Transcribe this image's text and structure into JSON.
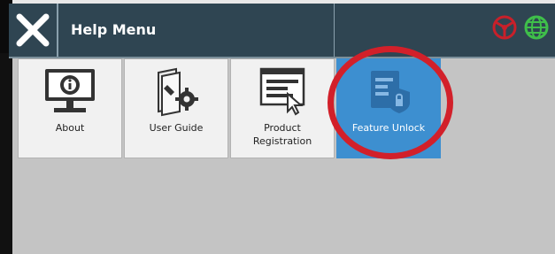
{
  "header": {
    "title": "Help Menu",
    "close_icon": "close-icon",
    "status_icons": [
      "steering-wheel-status-icon",
      "gnss-globe-status-icon"
    ],
    "colors": {
      "bar": "#2f4552",
      "accent_red": "#c8202a",
      "accent_green": "#3fbf4a"
    }
  },
  "tiles": [
    {
      "label": "About",
      "icon": "info-monitor-icon",
      "active": false
    },
    {
      "label": "User Guide",
      "icon": "user-guide-icon",
      "active": false
    },
    {
      "label": "Product\nRegistration",
      "icon": "product-registration-icon",
      "active": false
    },
    {
      "label": "Feature Unlock",
      "icon": "feature-unlock-icon",
      "active": true
    }
  ],
  "colors": {
    "active_tile": "#3d8fd0",
    "tile": "#f1f1f1",
    "background": "#c4c4c4",
    "highlight": "#d2202a"
  }
}
